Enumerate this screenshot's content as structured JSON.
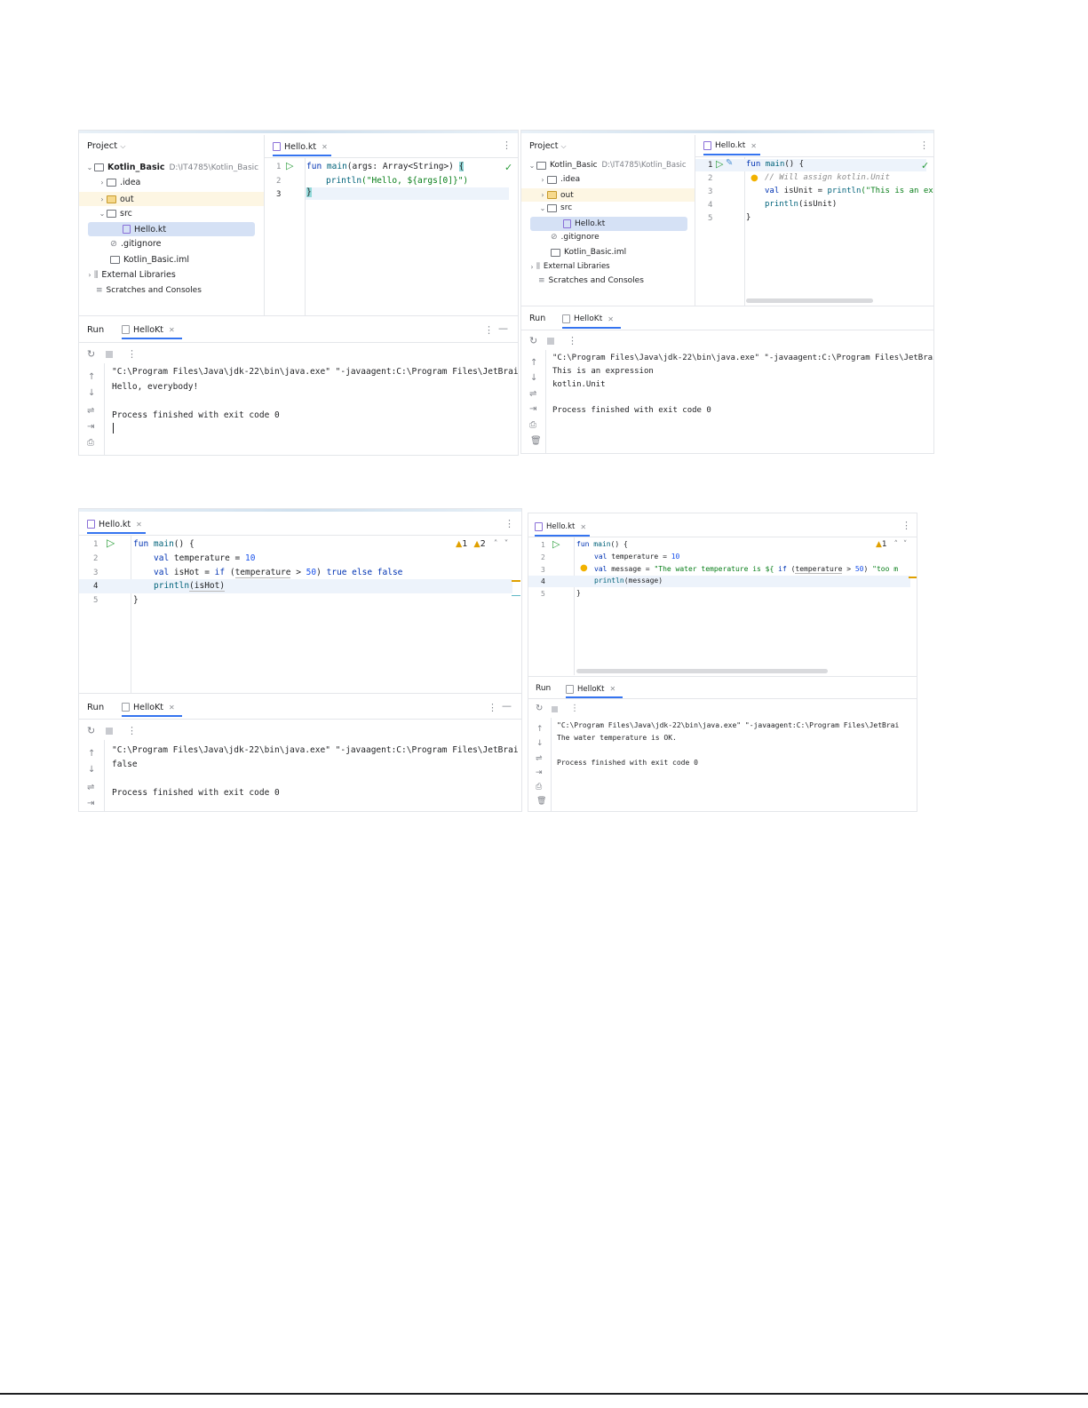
{
  "shot1": {
    "project_label": "Project",
    "root_name": "Kotlin_Basic",
    "root_path": "D:\\IT4785\\Kotlin_Basic",
    "tree": [
      ".idea",
      "out",
      "src",
      "Hello.kt",
      ".gitignore",
      "Kotlin_Basic.iml",
      "External Libraries",
      "Scratches and Consoles"
    ],
    "editor_tab": "Hello.kt",
    "line_numbers": [
      "1",
      "2",
      "3"
    ],
    "code": {
      "l1_kw": "fun",
      "l1_fn": "main",
      "l1_rest": "(args: Array<String>) ",
      "l1_brace": "{",
      "l2_fn": "println",
      "l2_str": "(\"Hello, ${args[0]}\")",
      "l3": "}"
    },
    "run_label": "Run",
    "run_tab": "HelloKt",
    "console": [
      "\"C:\\Program Files\\Java\\jdk-22\\bin\\java.exe\" \"-javaagent:C:\\Program Files\\JetBrai",
      "Hello, everybody!",
      "",
      "Process finished with exit code 0"
    ]
  },
  "shot2": {
    "project_label": "Project",
    "root_name": "Kotlin_Basic",
    "root_path": "D:\\IT4785\\Kotlin_Basic",
    "tree": [
      ".idea",
      "out",
      "src",
      "Hello.kt",
      ".gitignore",
      "Kotlin_Basic.iml",
      "External Libraries",
      "Scratches and Consoles"
    ],
    "editor_tab": "Hello.kt",
    "line_numbers": [
      "1",
      "2",
      "3",
      "4",
      "5"
    ],
    "code": {
      "l1_kw": "fun",
      "l1_fn": "main",
      "l1_rest": "() {",
      "l2_cmt": "// Will assign kotlin.Unit",
      "l3_kw": "val",
      "l3_rest": " isUnit = ",
      "l3_fn": "println",
      "l3_str": "(\"This is an ex",
      "l4_fn": "println",
      "l4_rest": "(isUnit)",
      "l5": "}"
    },
    "run_label": "Run",
    "run_tab": "HelloKt",
    "console": [
      "\"C:\\Program Files\\Java\\jdk-22\\bin\\java.exe\" \"-javaagent:C:\\Program Files\\JetBrai",
      "This is an expression",
      "kotlin.Unit",
      "",
      "Process finished with exit code 0"
    ]
  },
  "shot3": {
    "editor_tab": "Hello.kt",
    "line_numbers": [
      "1",
      "2",
      "3",
      "4",
      "5"
    ],
    "warnings": {
      "warn_count": "1",
      "weak_count": "2"
    },
    "code": {
      "l1_kw": "fun",
      "l1_fn": "main",
      "l1_rest": "() {",
      "l2_kw": "val",
      "l2_rest": " temperature = ",
      "l2_num": "10",
      "l3_kw": "val",
      "l3_rest1": " isHot = ",
      "l3_kw2": "if",
      "l3_rest2": " (",
      "l3_var": "temperature",
      "l3_rest3": " > ",
      "l3_num": "50",
      "l3_rest4": ") ",
      "l3_kw3": "true",
      "l3_kw4": " else ",
      "l3_kw5": "false",
      "l4_fn": "println",
      "l4_rest": "(isHot)",
      "l5": "}"
    },
    "run_label": "Run",
    "run_tab": "HelloKt",
    "console": [
      "\"C:\\Program Files\\Java\\jdk-22\\bin\\java.exe\" \"-javaagent:C:\\Program Files\\JetBrai",
      "false",
      "",
      "Process finished with exit code 0"
    ]
  },
  "shot4": {
    "editor_tab": "Hello.kt",
    "line_numbers": [
      "1",
      "2",
      "3",
      "4",
      "5"
    ],
    "warnings": {
      "warn_count": "1"
    },
    "code": {
      "l1_kw": "fun",
      "l1_fn": "main",
      "l1_rest": "() {",
      "l2_kw": "val",
      "l2_rest": " temperature = ",
      "l2_num": "10",
      "l3_kw": "val",
      "l3_rest": " message = ",
      "l3_str": "\"The water temperature is ${ ",
      "l3_kw2": "if",
      "l3_rest2": " (",
      "l3_var": "temperature",
      "l3_rest3": " > ",
      "l3_num": "50",
      "l3_rest4": ") ",
      "l3_str2": "\"too m",
      "l4_fn": "println",
      "l4_rest": "(message)",
      "l5": "}"
    },
    "run_label": "Run",
    "run_tab": "HelloKt",
    "console": [
      "\"C:\\Program Files\\Java\\jdk-22\\bin\\java.exe\" \"-javaagent:C:\\Program Files\\JetBrai",
      "The water temperature is OK.",
      "",
      "Process finished with exit code 0"
    ]
  },
  "icons": [
    "chevron-down-icon",
    "chevron-right-icon",
    "folder-icon",
    "kotlin-file-icon",
    "gitignore-icon",
    "iml-file-icon",
    "library-icon",
    "scratches-icon",
    "run-icon",
    "rerun-icon",
    "stop-icon",
    "more-icon",
    "up-arrow-icon",
    "down-arrow-icon",
    "soft-wrap-icon",
    "scroll-end-icon",
    "print-icon",
    "trash-icon",
    "check-icon",
    "bulb-icon",
    "warning-icon",
    "minimize-icon",
    "close-icon"
  ]
}
